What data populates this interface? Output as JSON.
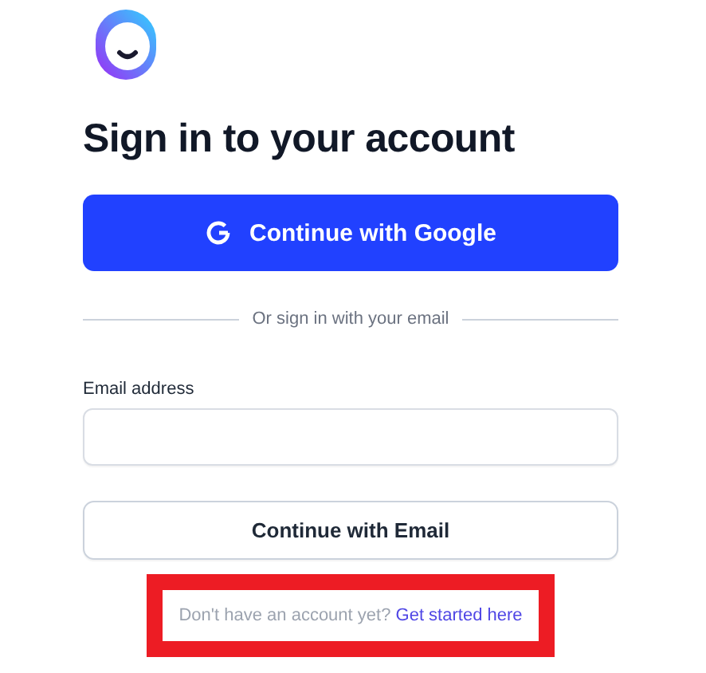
{
  "title": "Sign in to your account",
  "google_button": {
    "label": "Continue with Google"
  },
  "divider": {
    "label": "Or sign in with your email"
  },
  "email": {
    "label": "Email address"
  },
  "email_button": {
    "label": "Continue with Email"
  },
  "signup": {
    "text": "Don't have an account yet?",
    "link": "Get started here",
    "highlighted": true
  }
}
